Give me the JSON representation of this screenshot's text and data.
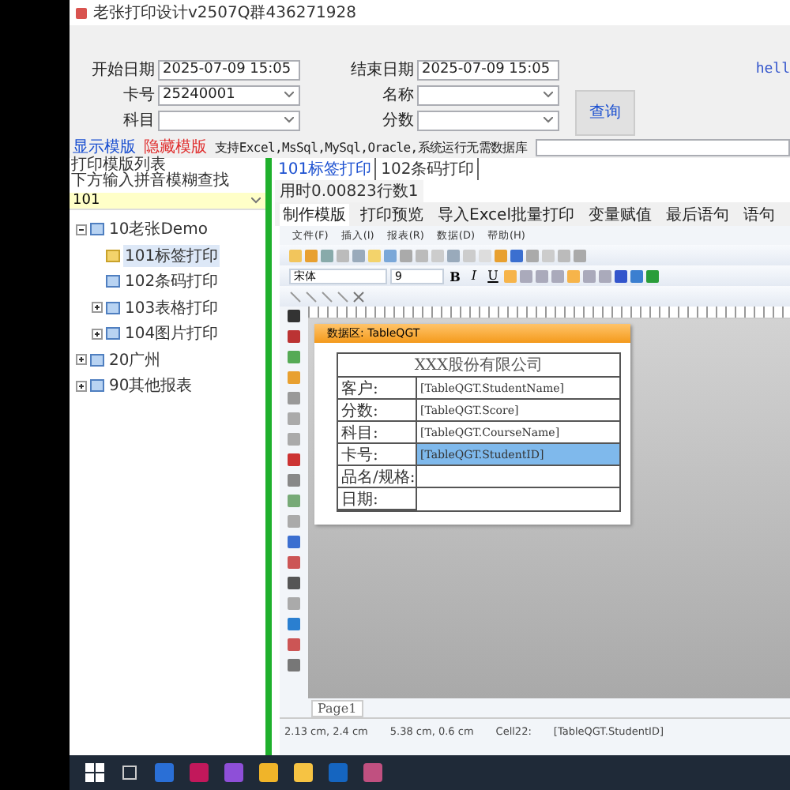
{
  "window": {
    "title": "老张打印设计v2507Q群436271928"
  },
  "filters": [
    {
      "label": "开始日期",
      "value": "2025-07-09 15:05",
      "kind": "date"
    },
    {
      "label": "结束日期",
      "value": "2025-07-09 15:05",
      "kind": "date"
    },
    {
      "label": "卡号",
      "value": "25240001",
      "kind": "combo"
    },
    {
      "label": "名称",
      "kind": "combo"
    },
    {
      "label": "科目",
      "kind": "combo"
    },
    {
      "label": "分数",
      "kind": "combo"
    }
  ],
  "query_button": "查询",
  "corner_text": "hell",
  "links": [
    {
      "text": "显示模版",
      "color": "#1a4fd0"
    },
    {
      "text": "隐藏模版",
      "color": "#e03030"
    }
  ],
  "support_note": "支持Excel,MsSql,MySql,Oracle,系统运行无需数据库",
  "template_list": {
    "title_lines": [
      "打印模版列表",
      "下方输入拼音模糊查找"
    ],
    "search_value": "101",
    "tree": [
      {
        "label": "10老张Demo",
        "expanded": true,
        "selected": false,
        "children": [
          {
            "label": "101标签打印",
            "selected": true
          },
          {
            "label": "102条码打印",
            "selected": false
          },
          {
            "label": "103表格打印",
            "expanded": false,
            "selected": false
          },
          {
            "label": "104图片打印",
            "expanded": false,
            "selected": false
          }
        ]
      },
      {
        "label": "20广州",
        "expanded": false,
        "selected": false
      },
      {
        "label": "90其他报表",
        "expanded": false,
        "selected": false
      }
    ]
  },
  "report_tabs": [
    {
      "label": "101标签打印",
      "selected": true
    },
    {
      "label": "102条码打印",
      "selected": false
    }
  ],
  "timing": "用时0.00823行数1",
  "designer_tabs": [
    {
      "label": "制作模版",
      "selected": true
    },
    {
      "label": "打印预览",
      "selected": false
    },
    {
      "label": "导入Excel批量打印",
      "selected": false
    },
    {
      "label": "变量赋值",
      "selected": false
    },
    {
      "label": "最后语句",
      "selected": false
    },
    {
      "label": "语句",
      "selected": false
    }
  ],
  "menu": [
    "文件(F)",
    "插入(I)",
    "报表(R)",
    "数据(D)",
    "帮助(H)"
  ],
  "font": {
    "name": "宋体",
    "size": "9"
  },
  "format_buttons": [
    "B",
    "I",
    "U"
  ],
  "band": "数据区: TableQGT",
  "report": {
    "title": "XXX股份有限公司",
    "rows": [
      {
        "label": "客户:",
        "value": "[TableQGT.StudentName]",
        "selected": false
      },
      {
        "label": "分数:",
        "value": "[TableQGT.Score]",
        "selected": false
      },
      {
        "label": "科目:",
        "value": "[TableQGT.CourseName]",
        "selected": false
      },
      {
        "label": "卡号:",
        "value": "[TableQGT.StudentID]",
        "selected": true
      },
      {
        "label": "品名/规格:",
        "selected": false
      },
      {
        "label": "日期:",
        "selected": false
      }
    ]
  },
  "page_tab": "Page1",
  "status": {
    "position": "2.13 cm, 2.4 cm",
    "size": "5.38 cm, 0.6 cm",
    "cell": "Cell22:",
    "cell_value": "[TableQGT.StudentID]"
  }
}
